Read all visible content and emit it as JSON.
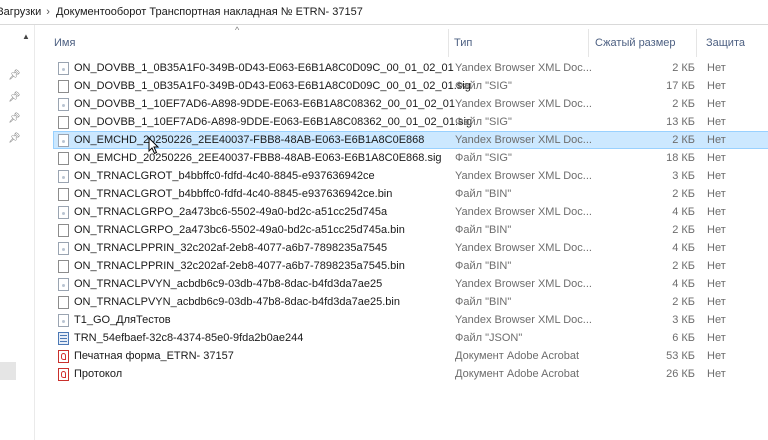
{
  "breadcrumb": {
    "items": [
      "Загрузки",
      "Документооборот Транспортная накладная № ETRN- 37157"
    ],
    "separator": "›"
  },
  "columns": {
    "name": "Имя",
    "type": "Тип",
    "size": "Сжатый размер",
    "protected": "Защита"
  },
  "sort_indicator": "^",
  "nav": {
    "pin_icon": "pin-icon",
    "scroll_up": "▲"
  },
  "files": [
    {
      "name": "ON_DOVBB_1_0B35A1F0-349B-0D43-E063-E6B1A8C0D09C_00_01_02_01",
      "type": "Yandex Browser XML Doc...",
      "size": "2 КБ",
      "protected": "Нет",
      "icon": "xml-file-icon"
    },
    {
      "name": "ON_DOVBB_1_0B35A1F0-349B-0D43-E063-E6B1A8C0D09C_00_01_02_01.sig",
      "type": "Файл \"SIG\"",
      "size": "17 КБ",
      "protected": "Нет",
      "icon": "file-icon"
    },
    {
      "name": "ON_DOVBB_1_10EF7AD6-A898-9DDE-E063-E6B1A8C08362_00_01_02_01",
      "type": "Yandex Browser XML Doc...",
      "size": "2 КБ",
      "protected": "Нет",
      "icon": "xml-file-icon"
    },
    {
      "name": "ON_DOVBB_1_10EF7AD6-A898-9DDE-E063-E6B1A8C08362_00_01_02_01.sig",
      "type": "Файл \"SIG\"",
      "size": "13 КБ",
      "protected": "Нет",
      "icon": "file-icon"
    },
    {
      "name": "ON_EMCHD_20250226_2EE40037-FBB8-48AB-E063-E6B1A8C0E868",
      "type": "Yandex Browser XML Doc...",
      "size": "2 КБ",
      "protected": "Нет",
      "icon": "xml-file-icon",
      "selected": true
    },
    {
      "name": "ON_EMCHD_20250226_2EE40037-FBB8-48AB-E063-E6B1A8C0E868.sig",
      "type": "Файл \"SIG\"",
      "size": "18 КБ",
      "protected": "Нет",
      "icon": "file-icon"
    },
    {
      "name": "ON_TRNACLGROT_b4bbffc0-fdfd-4c40-8845-e937636942ce",
      "type": "Yandex Browser XML Doc...",
      "size": "3 КБ",
      "protected": "Нет",
      "icon": "xml-file-icon"
    },
    {
      "name": "ON_TRNACLGROT_b4bbffc0-fdfd-4c40-8845-e937636942ce.bin",
      "type": "Файл \"BIN\"",
      "size": "2 КБ",
      "protected": "Нет",
      "icon": "file-icon"
    },
    {
      "name": "ON_TRNACLGRPO_2a473bc6-5502-49a0-bd2c-a51cc25d745a",
      "type": "Yandex Browser XML Doc...",
      "size": "4 КБ",
      "protected": "Нет",
      "icon": "xml-file-icon"
    },
    {
      "name": "ON_TRNACLGRPO_2a473bc6-5502-49a0-bd2c-a51cc25d745a.bin",
      "type": "Файл \"BIN\"",
      "size": "2 КБ",
      "protected": "Нет",
      "icon": "file-icon"
    },
    {
      "name": "ON_TRNACLPPRIN_32c202af-2eb8-4077-a6b7-7898235a7545",
      "type": "Yandex Browser XML Doc...",
      "size": "4 КБ",
      "protected": "Нет",
      "icon": "xml-file-icon"
    },
    {
      "name": "ON_TRNACLPPRIN_32c202af-2eb8-4077-a6b7-7898235a7545.bin",
      "type": "Файл \"BIN\"",
      "size": "2 КБ",
      "protected": "Нет",
      "icon": "file-icon"
    },
    {
      "name": "ON_TRNACLPVYN_acbdb6c9-03db-47b8-8dac-b4fd3da7ae25",
      "type": "Yandex Browser XML Doc...",
      "size": "4 КБ",
      "protected": "Нет",
      "icon": "xml-file-icon"
    },
    {
      "name": "ON_TRNACLPVYN_acbdb6c9-03db-47b8-8dac-b4fd3da7ae25.bin",
      "type": "Файл \"BIN\"",
      "size": "2 КБ",
      "protected": "Нет",
      "icon": "file-icon"
    },
    {
      "name": "T1_GO_ДляТестов",
      "type": "Yandex Browser XML Doc...",
      "size": "3 КБ",
      "protected": "Нет",
      "icon": "xml-file-icon"
    },
    {
      "name": "TRN_54efbaef-32c8-4374-85e0-9fda2b0ae244",
      "type": "Файл \"JSON\"",
      "size": "6 КБ",
      "protected": "Нет",
      "icon": "json-file-icon"
    },
    {
      "name": "Печатная форма_ETRN- 37157",
      "type": "Документ Adobe Acrobat",
      "size": "53 КБ",
      "protected": "Нет",
      "icon": "pdf-file-icon"
    },
    {
      "name": "Протокол",
      "type": "Документ Adobe Acrobat",
      "size": "26 КБ",
      "protected": "Нет",
      "icon": "pdf-file-icon"
    }
  ]
}
